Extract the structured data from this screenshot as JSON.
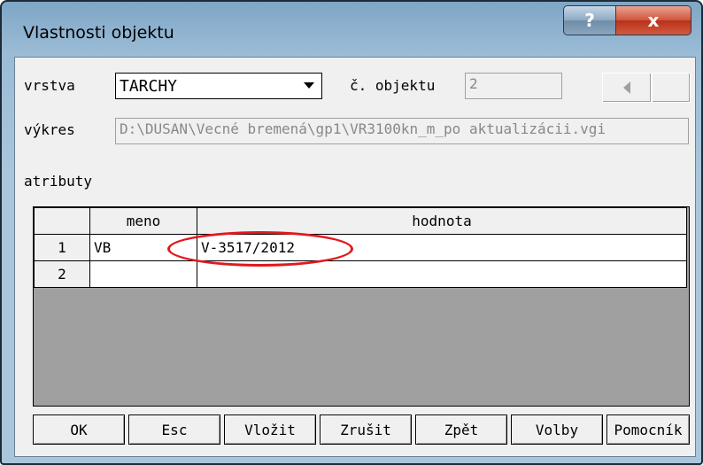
{
  "window": {
    "title": "Vlastnosti objektu",
    "help_label": "?",
    "close_label": "x"
  },
  "form": {
    "vrstva_label": "vrstva",
    "vrstva_value": "TARCHY",
    "objekt_label": "č. objektu",
    "objekt_value": "2",
    "vykres_label": "výkres",
    "vykres_value": "D:\\DUSAN\\Vecné bremená\\gp1\\VR3100kn_m_po aktualizácii.vgi",
    "atributy_label": "atributy"
  },
  "table": {
    "headers": [
      "",
      "meno",
      "hodnota"
    ],
    "rows": [
      {
        "num": "1",
        "meno": "VB",
        "hodnota": "V-3517/2012"
      },
      {
        "num": "2",
        "meno": "",
        "hodnota": ""
      }
    ]
  },
  "buttons": {
    "ok": "OK",
    "esc": "Esc",
    "vlozit": "Vložit",
    "zrusit": "Zrušit",
    "zpet": "Zpět",
    "volby": "Volby",
    "pomocnik": "Pomocník"
  },
  "colors": {
    "annotation_circle": "#e0191e",
    "close_button": "#c8412a"
  }
}
